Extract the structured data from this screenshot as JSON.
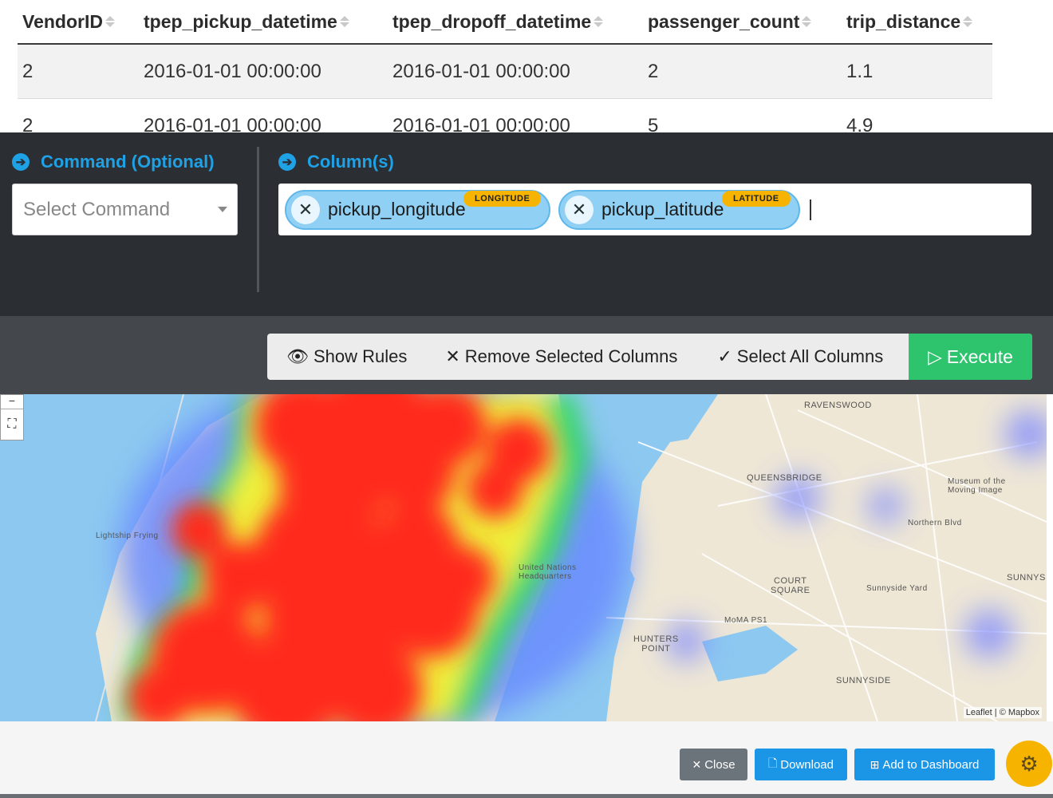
{
  "table": {
    "columns": [
      "VendorID",
      "tpep_pickup_datetime",
      "tpep_dropoff_datetime",
      "passenger_count",
      "trip_distance"
    ],
    "rows": [
      [
        "2",
        "2016-01-01 00:00:00",
        "2016-01-01 00:00:00",
        "2",
        "1.1"
      ],
      [
        "2",
        "2016-01-01 00:00:00",
        "2016-01-01 00:00:00",
        "5",
        "4.9"
      ]
    ]
  },
  "command": {
    "label": "Command (Optional)",
    "placeholder": "Select Command"
  },
  "columns_input": {
    "label": "Column(s)",
    "chips": [
      {
        "name": "pickup_longitude",
        "badge": "LONGITUDE"
      },
      {
        "name": "pickup_latitude",
        "badge": "LATITUDE"
      }
    ]
  },
  "toolbar": {
    "show_rules": "Show Rules",
    "remove_columns": "Remove Selected Columns",
    "select_all": "Select All Columns",
    "execute": "Execute"
  },
  "map": {
    "labels": {
      "ravenswood": "RAVENSWOOD",
      "queensbridge": "QUEENSBRIDGE",
      "court_square": "COURT\nSQUARE",
      "hunters_point": "HUNTERS\nPOINT",
      "sunnyside": "SUNNYSIDE",
      "sunnyside_yard": "Sunnyside Yard",
      "un_hq": "United Nations\nHeadquarters",
      "museum": "Museum of the\nMoving Image",
      "moma": "MoMA PS1",
      "lightship": "Lightship Frying",
      "northern_blvd": "Northern Blvd",
      "sunnys": "SUNNYS"
    },
    "attribution": "Leaflet | © Mapbox"
  },
  "footer": {
    "close": "Close",
    "download": "Download",
    "add_dashboard": "Add to Dashboard"
  },
  "colors": {
    "panel": "#2b2e33",
    "accent": "#1fa1e6",
    "execute": "#2ec46d",
    "badge": "#f6b400"
  }
}
